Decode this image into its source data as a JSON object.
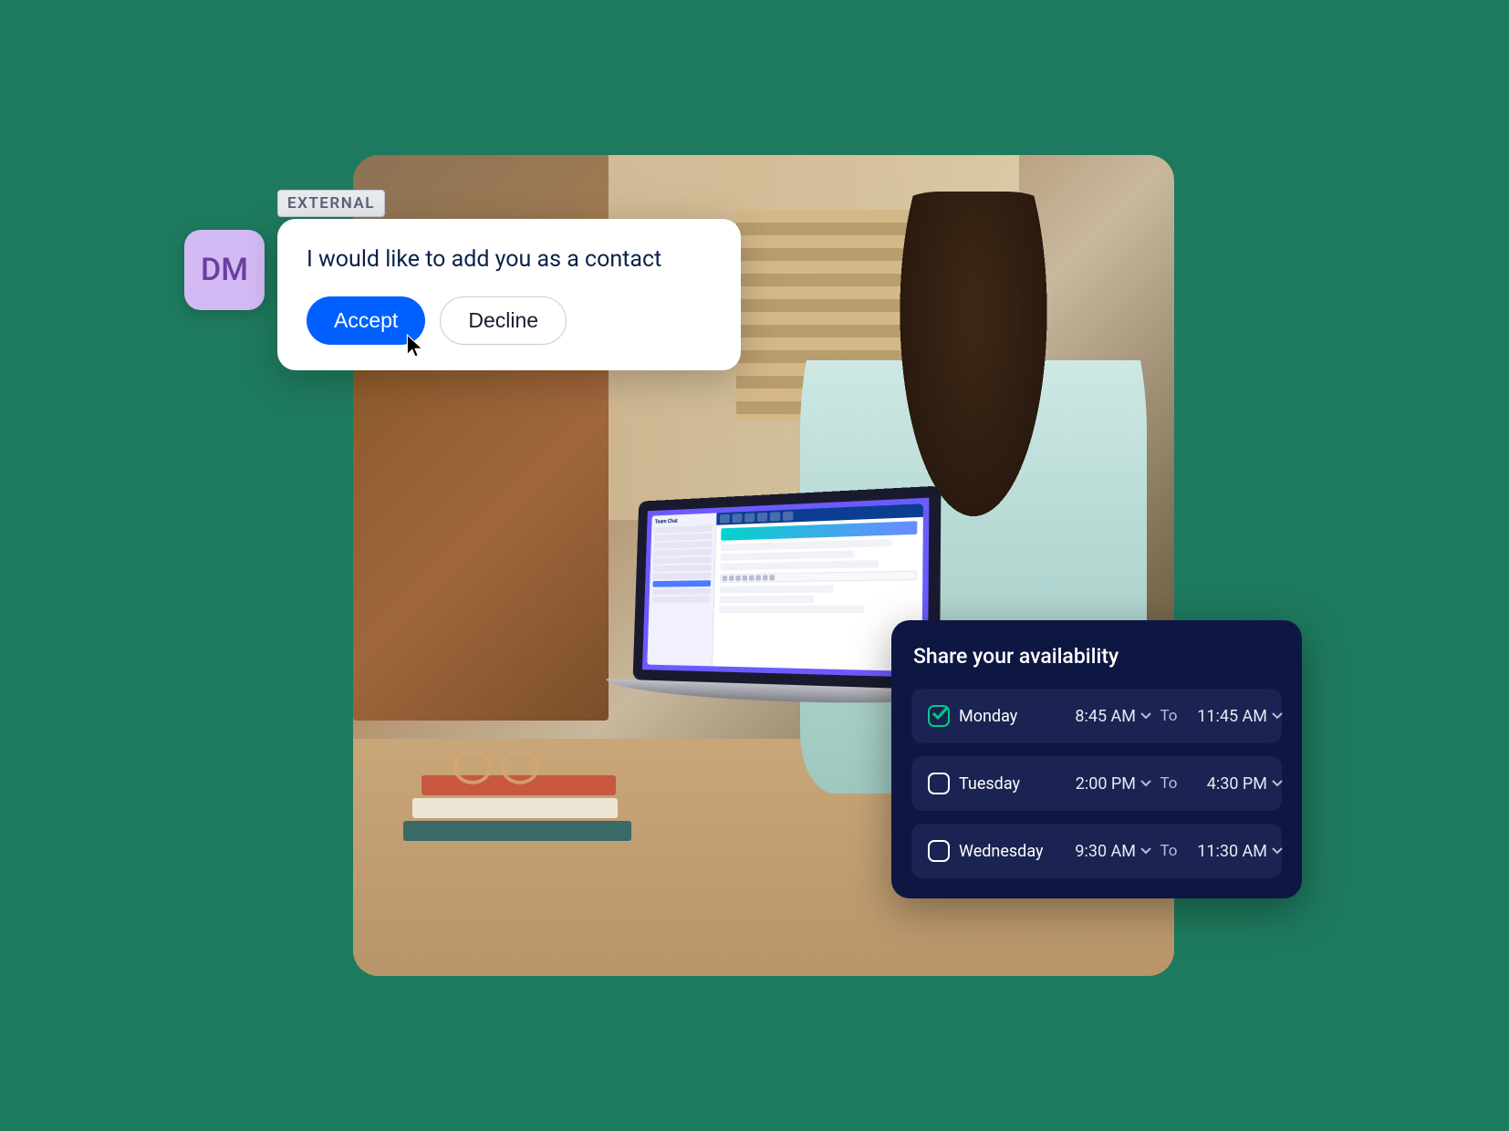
{
  "contact_request": {
    "avatar_initials": "DM",
    "badge": "EXTERNAL",
    "message": "I would like to add you as a contact",
    "accept_label": "Accept",
    "decline_label": "Decline"
  },
  "availability": {
    "title": "Share your availability",
    "to_label": "To",
    "rows": [
      {
        "day": "Monday",
        "checked": true,
        "start": "8:45 AM",
        "end": "11:45 AM"
      },
      {
        "day": "Tuesday",
        "checked": false,
        "start": "2:00 PM",
        "end": "4:30 PM"
      },
      {
        "day": "Wednesday",
        "checked": false,
        "start": "9:30 AM",
        "end": "11:30 AM"
      }
    ]
  },
  "laptop": {
    "sidebar_title": "Team Chat"
  },
  "colors": {
    "primary_blue": "#0060ff",
    "dark_navy": "#0e1642",
    "check_green": "#00cc88",
    "avatar_bg": "#d4baf5"
  }
}
